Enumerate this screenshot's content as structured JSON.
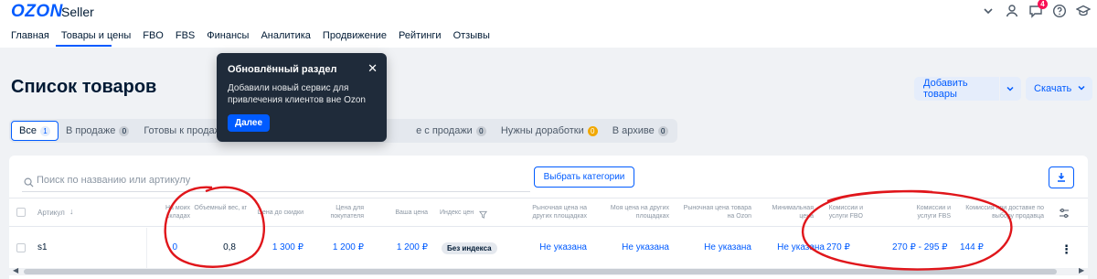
{
  "header": {
    "logo": "OZON",
    "product": "Seller",
    "nav": [
      "Главная",
      "Товары и цены",
      "FBO",
      "FBS",
      "Финансы",
      "Аналитика",
      "Продвижение",
      "Рейтинги",
      "Отзывы"
    ],
    "notifications_count": "4",
    "icons": [
      "chevron-down-icon",
      "user-icon",
      "chat-icon",
      "help-icon",
      "graduation-cap-icon"
    ]
  },
  "page": {
    "title": "Список товаров",
    "add_button": "Добавить товары",
    "download_button": "Скачать"
  },
  "tabs": [
    {
      "label": "Все",
      "count": "1",
      "active": true
    },
    {
      "label": "В продаже",
      "count": "0"
    },
    {
      "label": "Готовы к продаже",
      "count": "1"
    },
    {
      "label": "е с продажи",
      "count": "0"
    },
    {
      "label": "Нужны доработки",
      "count": "0",
      "warn": true
    },
    {
      "label": "В архиве",
      "count": "0"
    }
  ],
  "popover": {
    "title": "Обновлённый раздел",
    "text": "Добавили новый сервис для привлечения клиентов вне Ozon",
    "button": "Далее"
  },
  "toolbar": {
    "search_placeholder": "Поиск по названию или артикулу",
    "categories_button": "Выбрать категории"
  },
  "table": {
    "headers": {
      "article": "Артикул",
      "on_stock": "На моих складах",
      "volume_weight": "Объемный вес, кг",
      "price_before_discount": "Цена до скидки",
      "price_for_buyer": "Цена для покупателя",
      "your_price": "Ваша цена",
      "price_index": "Индекс цен",
      "market_price_other": "Рыночная цена на других площадках",
      "your_price_other": "Моя цена на других площадках",
      "market_price_ozon": "Рыночная цена товара на Ozon",
      "min_price": "Минимальная цена",
      "fbo_commission": "Комиссии и услуги FBO",
      "fbs_commission": "Комиссии и услуги FBS",
      "seller_delivery": "Комиссия при доставке по выбору продавца"
    },
    "rows": [
      {
        "article": "s1",
        "on_stock": "0",
        "volume_weight": "0,8",
        "price_before_discount": "1 300 ₽",
        "price_for_buyer": "1 200 ₽",
        "your_price": "1 200 ₽",
        "price_index": "Без индекса",
        "market_price_other": "Не указана",
        "your_price_other": "Не указана",
        "market_price_ozon": "Не указана",
        "min_price": "Не указана",
        "fbo_commission": "270 ₽",
        "fbs_commission": "270 ₽ - 295 ₽",
        "seller_delivery": "144 ₽"
      }
    ]
  },
  "colors": {
    "brand": "#005bff",
    "annotation": "#e0161b",
    "popover_bg": "#1f2b3a",
    "warn": "#f1a800"
  }
}
